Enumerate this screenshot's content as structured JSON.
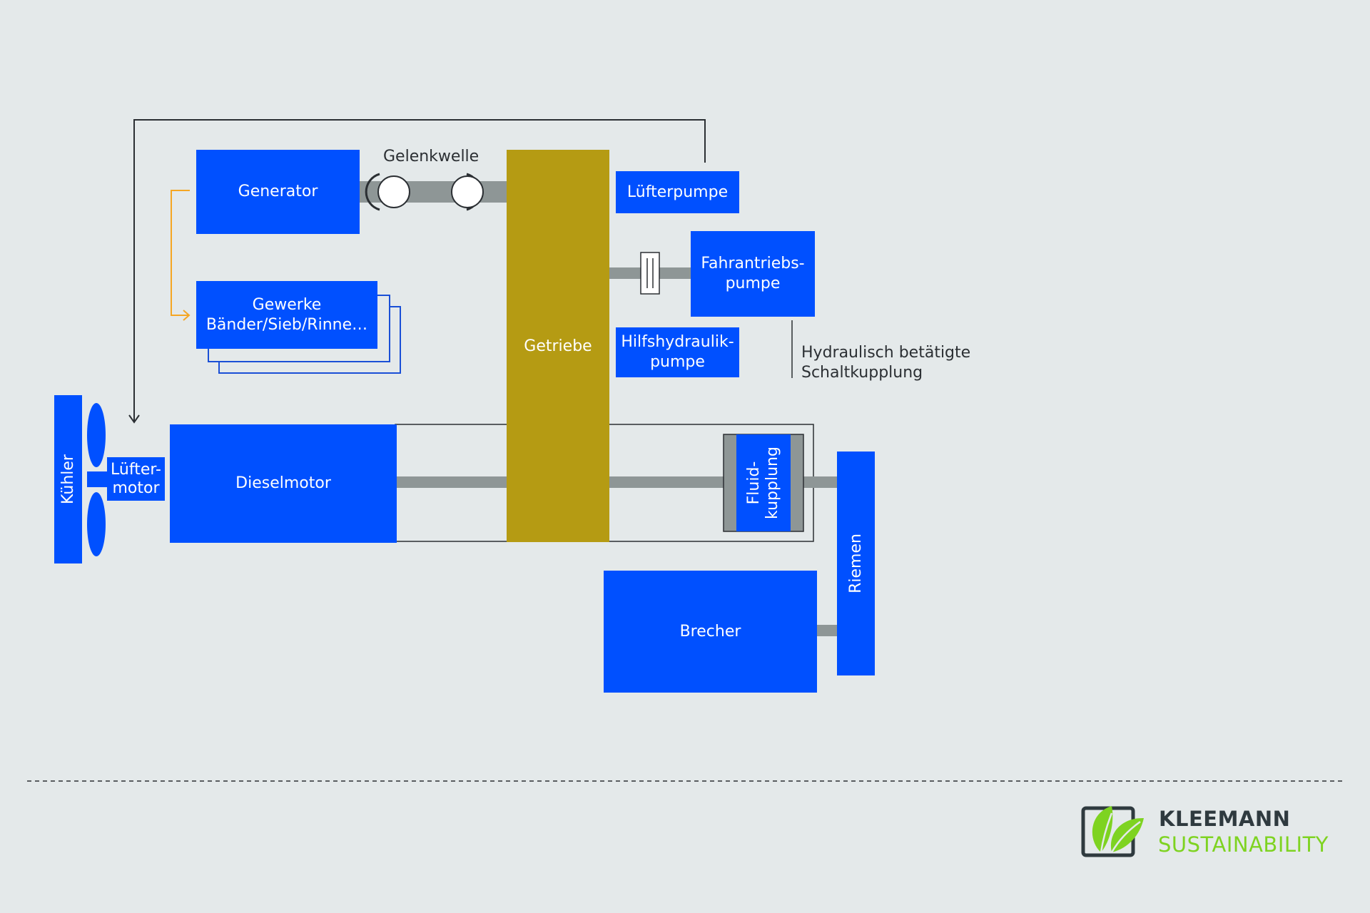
{
  "components": {
    "generator": "Generator",
    "gelenkwelle": "Gelenkwelle",
    "gewerke_line1": "Gewerke",
    "gewerke_line2": "Bänder/Sieb/Rinne…",
    "getriebe": "Getriebe",
    "luefterpumpe": "Lüfterpumpe",
    "fahrantriebs_line1": "Fahrantriebs-",
    "fahrantriebs_line2": "pumpe",
    "hilfshydraulik_line1": "Hilfshydraulik-",
    "hilfshydraulik_line2": "pumpe",
    "schaltkupplung_line1": "Hydraulisch betätigte",
    "schaltkupplung_line2": "Schaltkupplung",
    "kuehler": "Kühler",
    "luefter_line1": "Lüfter-",
    "luefter_line2": "motor",
    "dieselmotor": "Dieselmotor",
    "fluid_line1": "Fluid-",
    "fluid_line2": "kupplung",
    "riemen": "Riemen",
    "brecher": "Brecher"
  },
  "brand": {
    "line1": "KLEEMANN",
    "line2": "SUSTAINABILITY"
  },
  "colors": {
    "component_blue": "#0050ff",
    "gearbox_gold": "#b59b13",
    "shaft_gray": "#8e9696",
    "arrow_orange": "#f5a623",
    "brand_green": "#7ed321",
    "background": "#e4e9ea"
  }
}
